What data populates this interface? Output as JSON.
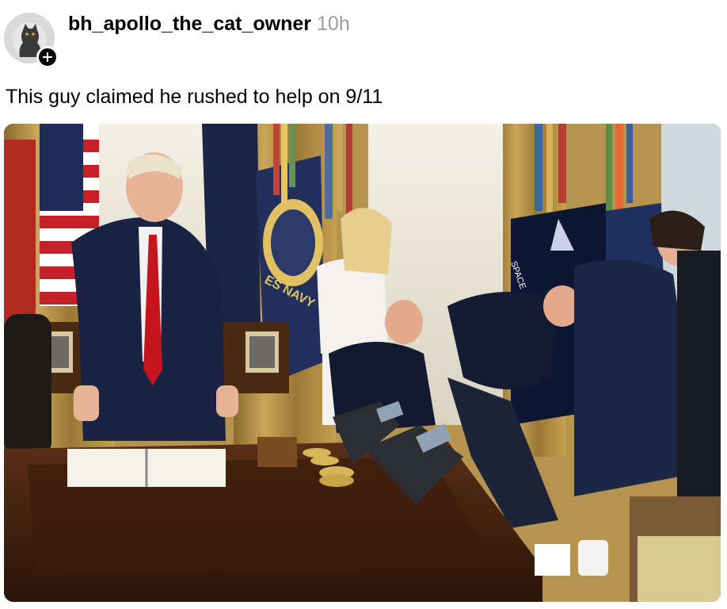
{
  "post": {
    "username": "bh_apollo_the_cat_owner",
    "time": "10h",
    "caption": "This guy claimed he rushed to help on 9/11",
    "avatar_icon": "cat-avatar",
    "follow_icon": "plus-icon"
  },
  "photo": {
    "flag_text_navy": "ES NAVY",
    "flag_text_space": "SPACE"
  }
}
